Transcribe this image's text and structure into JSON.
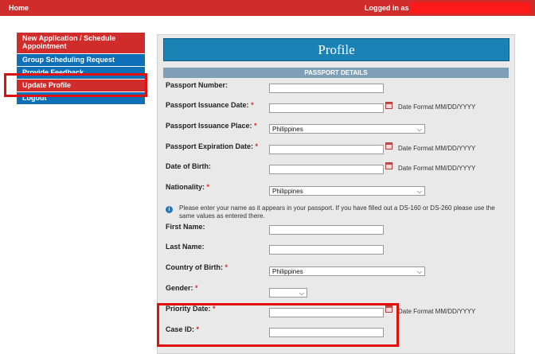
{
  "topbar": {
    "home": "Home",
    "logged_in": "Logged in as"
  },
  "sidebar": {
    "items": [
      {
        "label": "New Application / Schedule Appointment"
      },
      {
        "label": "Group Scheduling Request"
      },
      {
        "label": "Provide Feedback"
      },
      {
        "label": "Update Profile"
      },
      {
        "label": "Logout"
      }
    ]
  },
  "main": {
    "title": "Profile",
    "section": "PASSPORT DETAILS",
    "info_text": "Please enter your name as it appears in your passport. If you have filled out a DS-160 or DS-260 please use the same values as entered there.",
    "date_format": "Date Format MM/DD/YYYY",
    "fields": {
      "passport_number": {
        "label": "Passport Number:",
        "value": ""
      },
      "issuance_date": {
        "label": "Passport Issuance Date:",
        "value": ""
      },
      "issuance_place": {
        "label": "Passport Issuance Place:",
        "value": "Philippines"
      },
      "expiration_date": {
        "label": "Passport Expiration Date:",
        "value": ""
      },
      "dob": {
        "label": "Date of Birth:",
        "value": ""
      },
      "nationality": {
        "label": "Nationality:",
        "value": "Philippines"
      },
      "first_name": {
        "label": "First Name:",
        "value": ""
      },
      "last_name": {
        "label": "Last Name:",
        "value": ""
      },
      "country_of_birth": {
        "label": "Country of Birth:",
        "value": "Philippines"
      },
      "gender": {
        "label": "Gender:",
        "value": ""
      },
      "priority_date": {
        "label": "Priority Date:",
        "value": ""
      },
      "case_id": {
        "label": "Case ID:",
        "value": ""
      }
    },
    "required_mark": "*"
  },
  "colors": {
    "red": "#d12c2c",
    "blue": "#0f6fb6",
    "title_blue": "#1b82b6",
    "highlight": "#e01010"
  }
}
